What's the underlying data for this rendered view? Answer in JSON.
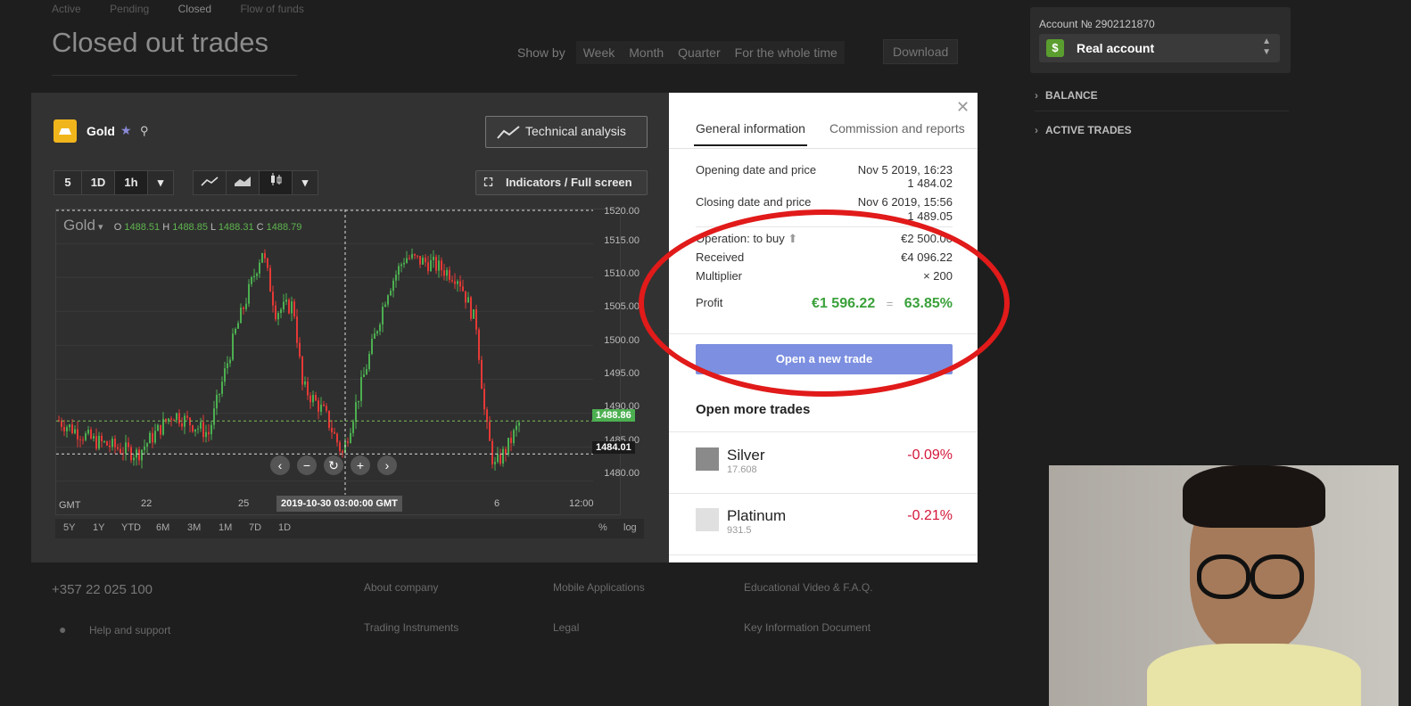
{
  "background": {
    "tabs": [
      "Active",
      "Pending",
      "Closed",
      "Flow of funds"
    ],
    "title": "Closed out trades",
    "show_by_label": "Show by",
    "show_by_options": [
      "Week",
      "Month",
      "Quarter",
      "For the whole time"
    ],
    "download": "Download"
  },
  "sidebar": {
    "account_number": "Account № 2902121870",
    "account_icon": "$",
    "account_label": "Real account",
    "items": [
      "BALANCE",
      "ACTIVE TRADES"
    ]
  },
  "chart_panel": {
    "asset_name": "Gold",
    "technical_analysis": "Technical analysis",
    "indicators": "Indicators / Full screen",
    "period_buttons": [
      "5",
      "1D",
      "1h"
    ],
    "ohlc": {
      "symbol": "Gold",
      "o": "1488.51",
      "h": "1488.85",
      "l": "1488.31",
      "c": "1488.79"
    },
    "ohlc_keys": {
      "o": "O",
      "h": "H",
      "l": "L",
      "c": "C"
    },
    "y_ticks": [
      "1520.00",
      "1515.00",
      "1510.00",
      "1505.00",
      "1500.00",
      "1495.00",
      "1490.00",
      "1485.00",
      "1480.00"
    ],
    "x_ticks": [
      "GMT",
      "22",
      "25",
      "6",
      "12:00"
    ],
    "price_tag_current": "1488.86",
    "price_tag_cross": "1484.01",
    "crosshair_time": "2019-10-30 03:00:00 GMT",
    "ranges": [
      "5Y",
      "1Y",
      "YTD",
      "6M",
      "3M",
      "1M",
      "7D",
      "1D"
    ],
    "scale_options": [
      "%",
      "log"
    ],
    "colors": {
      "up": "#4caf50",
      "down": "#e53935",
      "current_tag": "#4caf50"
    }
  },
  "details": {
    "tabs": [
      "General information",
      "Commission and reports"
    ],
    "opening_label": "Opening date and price",
    "opening_date": "Nov 5 2019, 16:23",
    "opening_price": "1 484.02",
    "closing_label": "Closing date and price",
    "closing_date": "Nov 6 2019, 15:56",
    "closing_price": "1 489.05",
    "operation_label": "Operation: to buy",
    "operation_value": "€2 500.00",
    "received_label": "Received",
    "received_value": "€4 096.22",
    "multiplier_label": "Multiplier",
    "multiplier_value": "× 200",
    "profit_label": "Profit",
    "profit_value": "€1 596.22",
    "profit_eq": "=",
    "profit_percent": "63.85%",
    "open_new_trade": "Open a new trade",
    "open_more_title": "Open more trades",
    "instruments": [
      {
        "name": "Silver",
        "price": "17.608",
        "change": "-0.09%"
      },
      {
        "name": "Platinum",
        "price": "931.5",
        "change": "-0.21%"
      }
    ]
  },
  "footer": {
    "phone": "+357 22 025 100",
    "help": "Help and support",
    "links": [
      "About company",
      "Mobile Applications",
      "Educational Video & F.A.Q.",
      "Trading Instruments",
      "Legal",
      "Key Information Document"
    ]
  }
}
